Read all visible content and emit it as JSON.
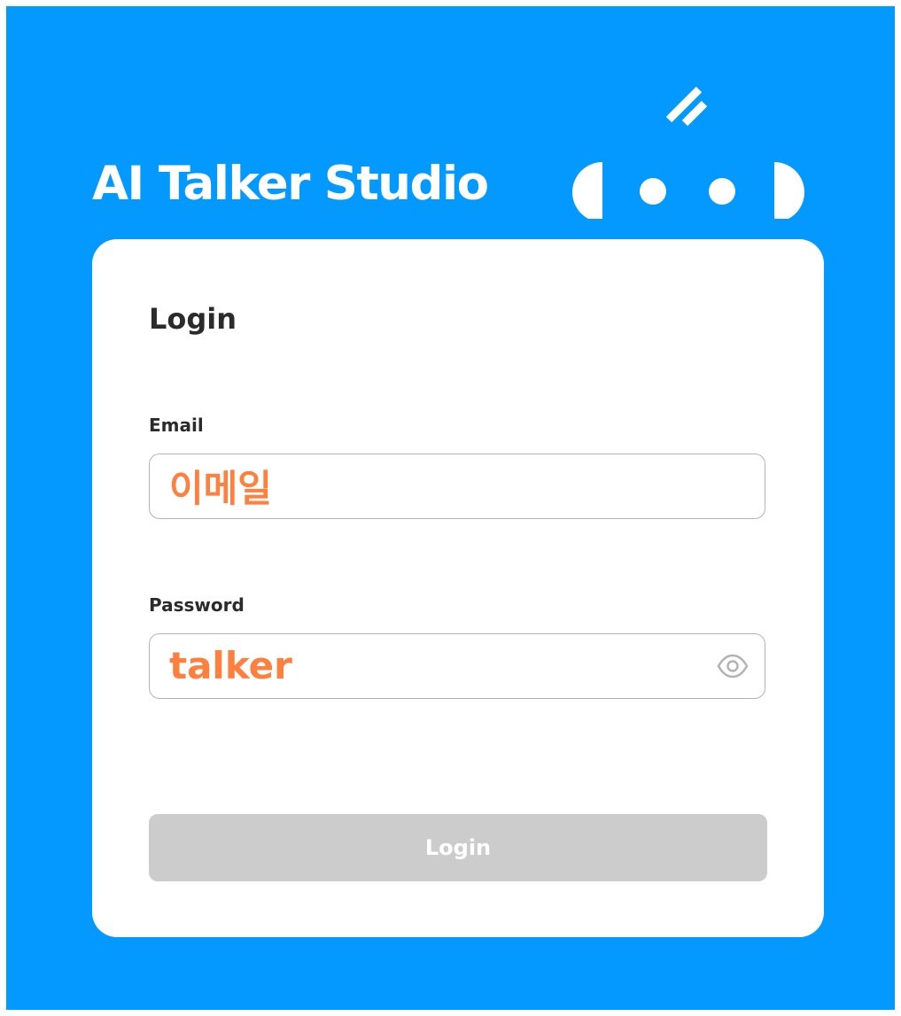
{
  "app": {
    "title": "AI Talker Studio"
  },
  "login_card": {
    "title": "Login",
    "email": {
      "label": "Email",
      "value": "이메일"
    },
    "password": {
      "label": "Password",
      "value": "talker",
      "toggle_icon": "eye-icon"
    },
    "submit_label": "Login"
  },
  "colors": {
    "background": "#0399fe",
    "card": "#ffffff",
    "input_text": "#fe7f3e",
    "button_disabled": "#cccccc",
    "label_text": "#2b2b2b"
  }
}
